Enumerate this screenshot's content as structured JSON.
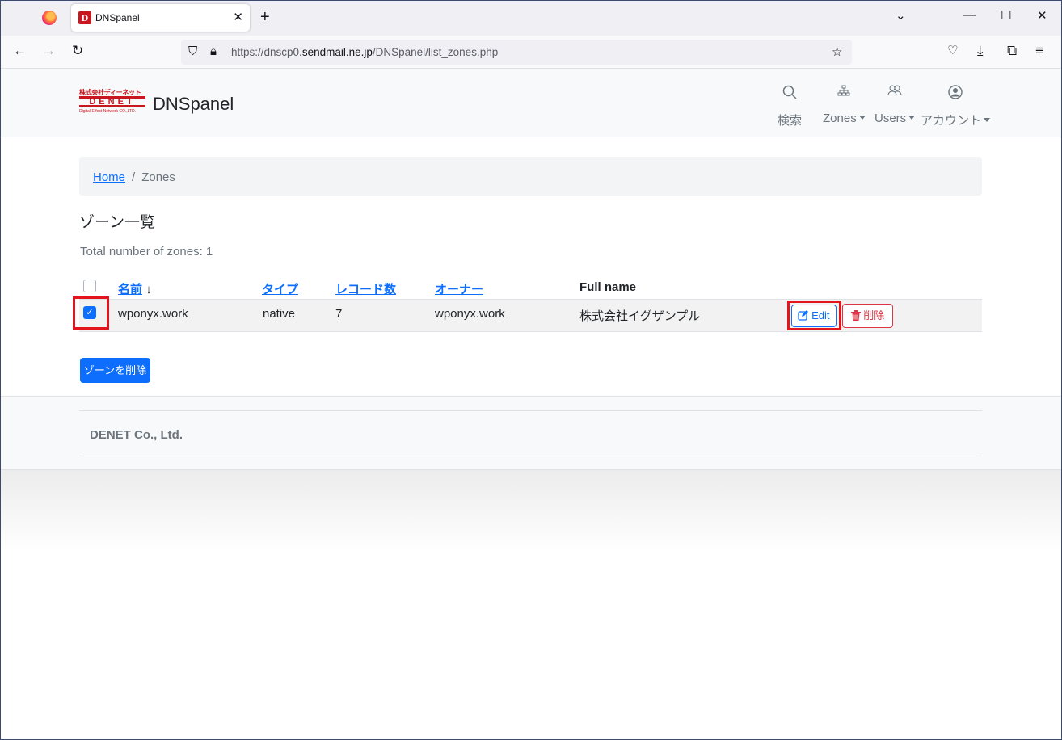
{
  "browser": {
    "tab_title": "DNSpanel",
    "tab_favicon": "D",
    "tab_close": "✕",
    "new_tab": "+",
    "url_prefix": "https://dnscp0.",
    "url_domain": "sendmail.ne.jp",
    "url_path": "/DNSpanel/list_zones.php"
  },
  "header": {
    "logo_top": "株式会社ディーネット",
    "logo_mid": "DENET",
    "logo_bottom": "Digital-Effect Network CO.,LTD.",
    "brand": "DNSpanel",
    "menu": [
      {
        "label": "検索",
        "icon": "search-icon",
        "glyph": "⌕",
        "dropdown": false
      },
      {
        "label": "Zones",
        "icon": "sitemap-icon",
        "glyph": "⊶",
        "dropdown": true
      },
      {
        "label": "Users",
        "icon": "users-icon",
        "glyph": "⚇",
        "dropdown": true
      },
      {
        "label": "アカウント",
        "icon": "account-icon",
        "glyph": "◉",
        "dropdown": true
      }
    ]
  },
  "breadcrumb": {
    "home": "Home",
    "separator": "/",
    "current": "Zones"
  },
  "page": {
    "title": "ゾーン一覧",
    "total": "Total number of zones: 1"
  },
  "table": {
    "headers": {
      "name": "名前",
      "name_sort": "↓",
      "type": "タイプ",
      "records": "レコード数",
      "owner": "オーナー",
      "fullname": "Full name"
    },
    "rows": [
      {
        "name": "wponyx.work",
        "type": "native",
        "records": "7",
        "owner": "wponyx.work",
        "fullname": "株式会社イグザンプル",
        "checked": true
      }
    ],
    "edit_label": "Edit",
    "delete_label": "削除"
  },
  "actions": {
    "delete_zones": "ゾーンを削除"
  },
  "footer": {
    "text": "DENET Co., Ltd."
  },
  "colors": {
    "primary": "#0d6efd",
    "danger": "#dc3545",
    "highlight": "#e3141c",
    "brand_red": "#c8171e"
  }
}
